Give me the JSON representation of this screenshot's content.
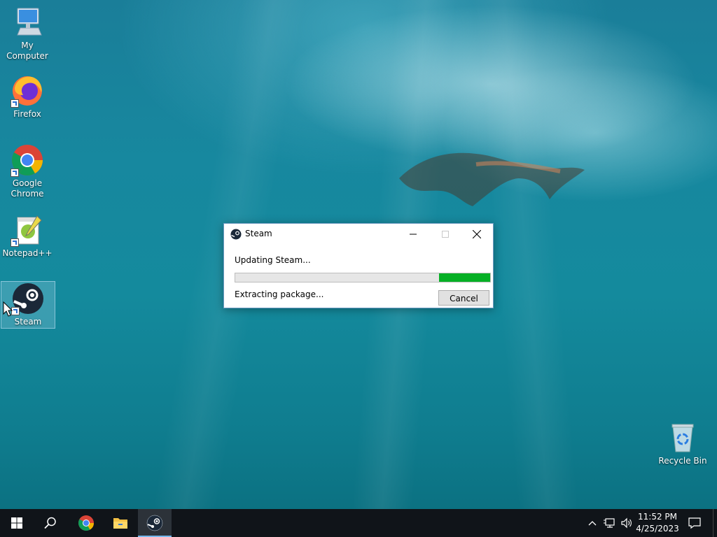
{
  "desktop": {
    "icons": [
      {
        "label": "My Computer",
        "icon": "computer-icon"
      },
      {
        "label": "Firefox",
        "icon": "firefox-icon"
      },
      {
        "label": "Google Chrome",
        "icon": "chrome-icon"
      },
      {
        "label": "Notepad++",
        "icon": "notepadpp-icon"
      },
      {
        "label": "Steam",
        "icon": "steam-icon"
      }
    ],
    "recycle_bin": {
      "label": "Recycle Bin",
      "icon": "recycle-bin-icon"
    }
  },
  "dialog": {
    "title": "Steam",
    "status": "Updating Steam...",
    "detail": "Extracting package...",
    "progress_percent": 20,
    "cancel_label": "Cancel",
    "progress_color": "#06b025"
  },
  "taskbar": {
    "items": [
      "start-icon",
      "search-icon",
      "chrome-icon",
      "file-explorer-icon",
      "steam-icon"
    ],
    "active_item": "steam-icon",
    "time": "11:52 PM",
    "date": "4/25/2023"
  }
}
